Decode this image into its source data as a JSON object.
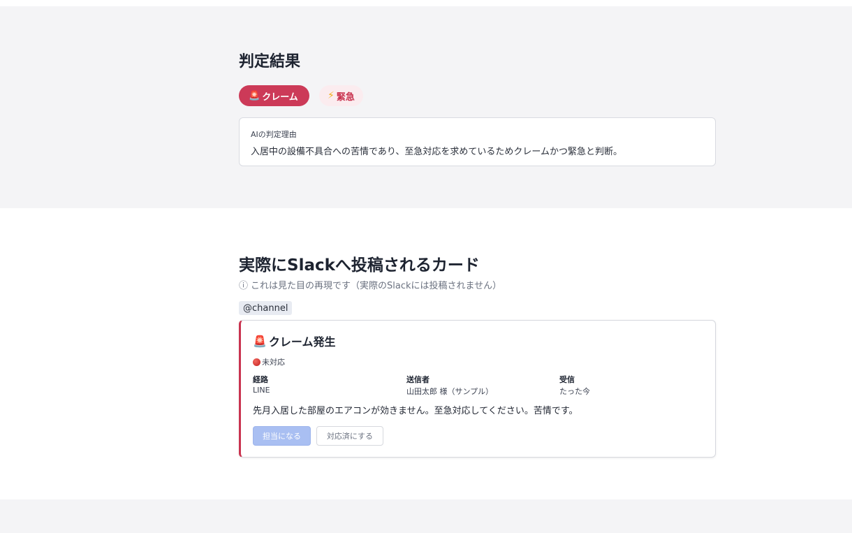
{
  "judgement": {
    "title": "判定結果",
    "badges": {
      "claim": {
        "icon": "rotating-light-icon",
        "glyph": "🚨",
        "label": "クレーム"
      },
      "urgent": {
        "icon": "lightning-icon",
        "glyph": "⚡",
        "label": "緊急"
      }
    },
    "reason_label": "AIの判定理由",
    "reason_text": "入居中の設備不具合への苦情であり、至急対応を求めているためクレームかつ緊急と判断。"
  },
  "slack_preview": {
    "title": "実際にSlackへ投稿されるカード",
    "note_icon": "info-icon",
    "note_glyph": "ⓘ",
    "note": "これは見た目の再現です（実際のSlackには投稿されません）",
    "mention": "@channel",
    "card": {
      "title_icon": "rotating-light-icon",
      "title_glyph": "🚨",
      "title": "クレーム発生",
      "status_icon": "red-circle-icon",
      "status": "未対応",
      "fields": [
        {
          "label": "経路",
          "value": "LINE"
        },
        {
          "label": "送信者",
          "value": "山田太郎 様（サンプル）"
        },
        {
          "label": "受信",
          "value": "たった今"
        }
      ],
      "message": "先月入居した部屋のエアコンが効きません。至急対応してください。苦情です。",
      "buttons": {
        "assign": "担当になる",
        "done": "対応済にする"
      }
    }
  },
  "colors": {
    "claim_badge_bg": "#cc3a58",
    "urgent_badge_bg": "#fbecef",
    "urgent_text": "#c9334f",
    "card_accent": "#c9334f",
    "assign_button_bg": "#a9bff2"
  }
}
